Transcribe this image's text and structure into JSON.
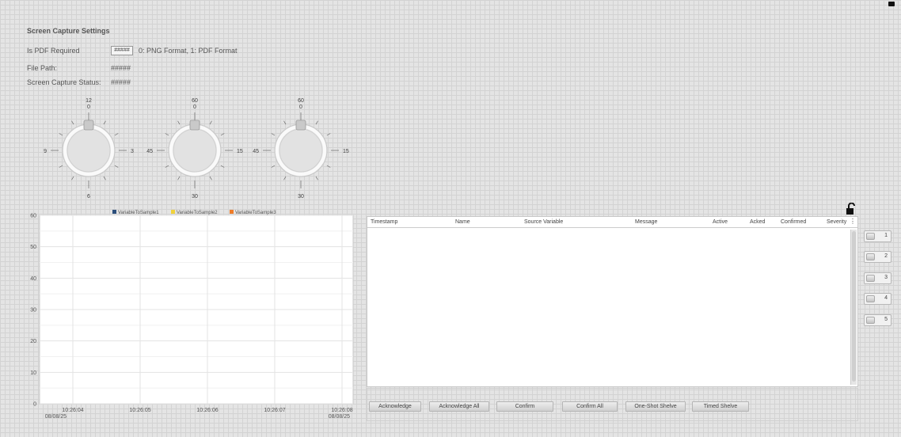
{
  "settings": {
    "title": "Screen Capture Settings",
    "pdf_label": "Is PDF Required",
    "pdf_value": "#####",
    "pdf_hint": "0: PNG Format, 1: PDF Format",
    "file_path_label": "File Path:",
    "file_path_value": "#####",
    "status_label": "Screen Capture Status:",
    "status_value": "#####"
  },
  "dials": [
    {
      "top": "12",
      "top2": "0",
      "left": "9",
      "right": "3",
      "bottom": "6"
    },
    {
      "top": "60",
      "top2": "0",
      "left": "45",
      "right": "15",
      "bottom": "30"
    },
    {
      "top": "60",
      "top2": "0",
      "left": "45",
      "right": "15",
      "bottom": "30"
    }
  ],
  "chart_data": {
    "type": "line",
    "title": "",
    "xlabel": "",
    "ylabel": "",
    "ylim": [
      0,
      60
    ],
    "yticks": [
      "0",
      "10",
      "20",
      "30",
      "40",
      "50",
      "60"
    ],
    "x_ticks": [
      {
        "time": "10:26:04",
        "date": "08/08/25"
      },
      {
        "time": "10:26:05",
        "date": ""
      },
      {
        "time": "10:26:06",
        "date": ""
      },
      {
        "time": "10:26:07",
        "date": ""
      },
      {
        "time": "10:26:08",
        "date": "08/08/25"
      }
    ],
    "series": [
      {
        "name": "VariableToSample1",
        "color": "#2c4f7c",
        "values": []
      },
      {
        "name": "VariableToSample2",
        "color": "#f0d23c",
        "values": []
      },
      {
        "name": "VariableToSample3",
        "color": "#ee7d2a",
        "values": []
      }
    ],
    "grid": true,
    "legend": "top"
  },
  "alarm_table": {
    "columns": [
      "Timestamp",
      "Name",
      "Source Variable",
      "Message",
      "Active",
      "Acked",
      "Confirmed",
      "Severity"
    ],
    "rows": []
  },
  "buttons": [
    "Acknowledge",
    "Acknowledge All",
    "Confirm",
    "Confirm All",
    "One-Shot Shelve",
    "Timed Shelve"
  ],
  "side_buttons": [
    "1",
    "2",
    "3",
    "4",
    "5"
  ],
  "icons": {
    "lock": "lock-open-icon",
    "corner": "lock-icon",
    "menu": "column-menu-icon"
  }
}
